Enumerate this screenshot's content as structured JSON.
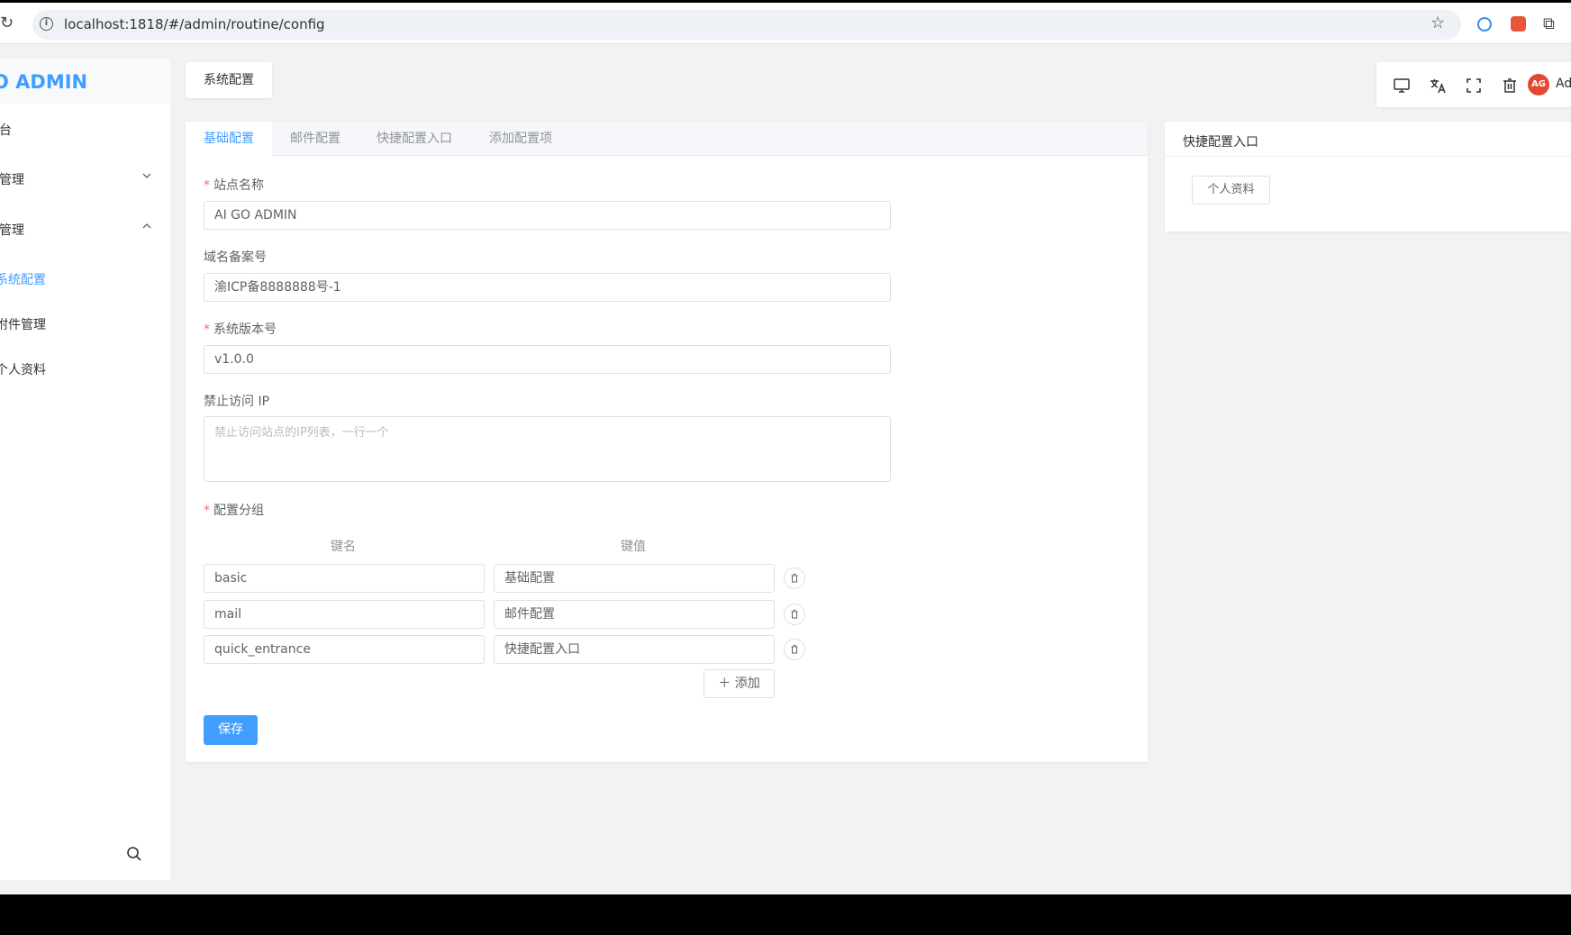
{
  "browser": {
    "url": "localhost:1818/#/admin/routine/config"
  },
  "sidebar": {
    "logo": "O ADMIN",
    "items": [
      {
        "label": "台"
      },
      {
        "label": "管理"
      },
      {
        "label": "管理"
      },
      {
        "label": "系统配置"
      },
      {
        "label": "附件管理"
      },
      {
        "label": "个人资料"
      }
    ]
  },
  "header": {
    "tag_label": "系统配置",
    "avatar_text": "AG",
    "user_name": "Ad"
  },
  "tabs": [
    {
      "label": "基础配置"
    },
    {
      "label": "邮件配置"
    },
    {
      "label": "快捷配置入口"
    },
    {
      "label": "添加配置项"
    }
  ],
  "form": {
    "site_name": {
      "label": "站点名称",
      "value": "AI GO ADMIN"
    },
    "icp": {
      "label": "域名备案号",
      "value": "渝ICP备8888888号-1"
    },
    "version": {
      "label": "系统版本号",
      "value": "v1.0.0"
    },
    "forbidden_ip": {
      "label": "禁止访问 IP",
      "placeholder": "禁止访问站点的IP列表，一行一个"
    },
    "group": {
      "label": "配置分组",
      "key_header": "键名",
      "value_header": "键值",
      "rows": [
        {
          "key": "basic",
          "value": "基础配置"
        },
        {
          "key": "mail",
          "value": "邮件配置"
        },
        {
          "key": "quick_entrance",
          "value": "快捷配置入口"
        }
      ],
      "add_label": "添加"
    },
    "save_label": "保存"
  },
  "quick": {
    "title": "快捷配置入口",
    "items": [
      {
        "label": "个人资料"
      }
    ]
  },
  "colors": {
    "primary": "#409eff",
    "danger": "#f56c6c"
  }
}
